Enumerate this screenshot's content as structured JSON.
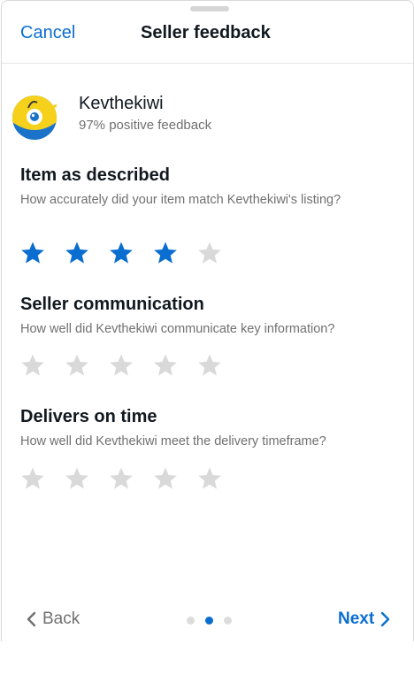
{
  "header": {
    "cancel_label": "Cancel",
    "title": "Seller feedback"
  },
  "seller": {
    "name": "Kevthekiwi",
    "feedback": "97% positive feedback"
  },
  "sections": [
    {
      "title": "Item as described",
      "question": "How accurately did your item match Kevthekiwi's listing?",
      "rating": 4,
      "max": 5
    },
    {
      "title": "Seller communication",
      "question": "How well did Kevthekiwi communicate key information?",
      "rating": 0,
      "max": 5
    },
    {
      "title": "Delivers on time",
      "question": "How well did Kevthekiwi meet the delivery timeframe?",
      "rating": 0,
      "max": 5
    }
  ],
  "footer": {
    "back_label": "Back",
    "next_label": "Next",
    "page_count": 3,
    "current_page": 2
  },
  "colors": {
    "accent": "#0a6ed1",
    "star_empty": "#d9d9d9",
    "muted_text": "#707070"
  }
}
